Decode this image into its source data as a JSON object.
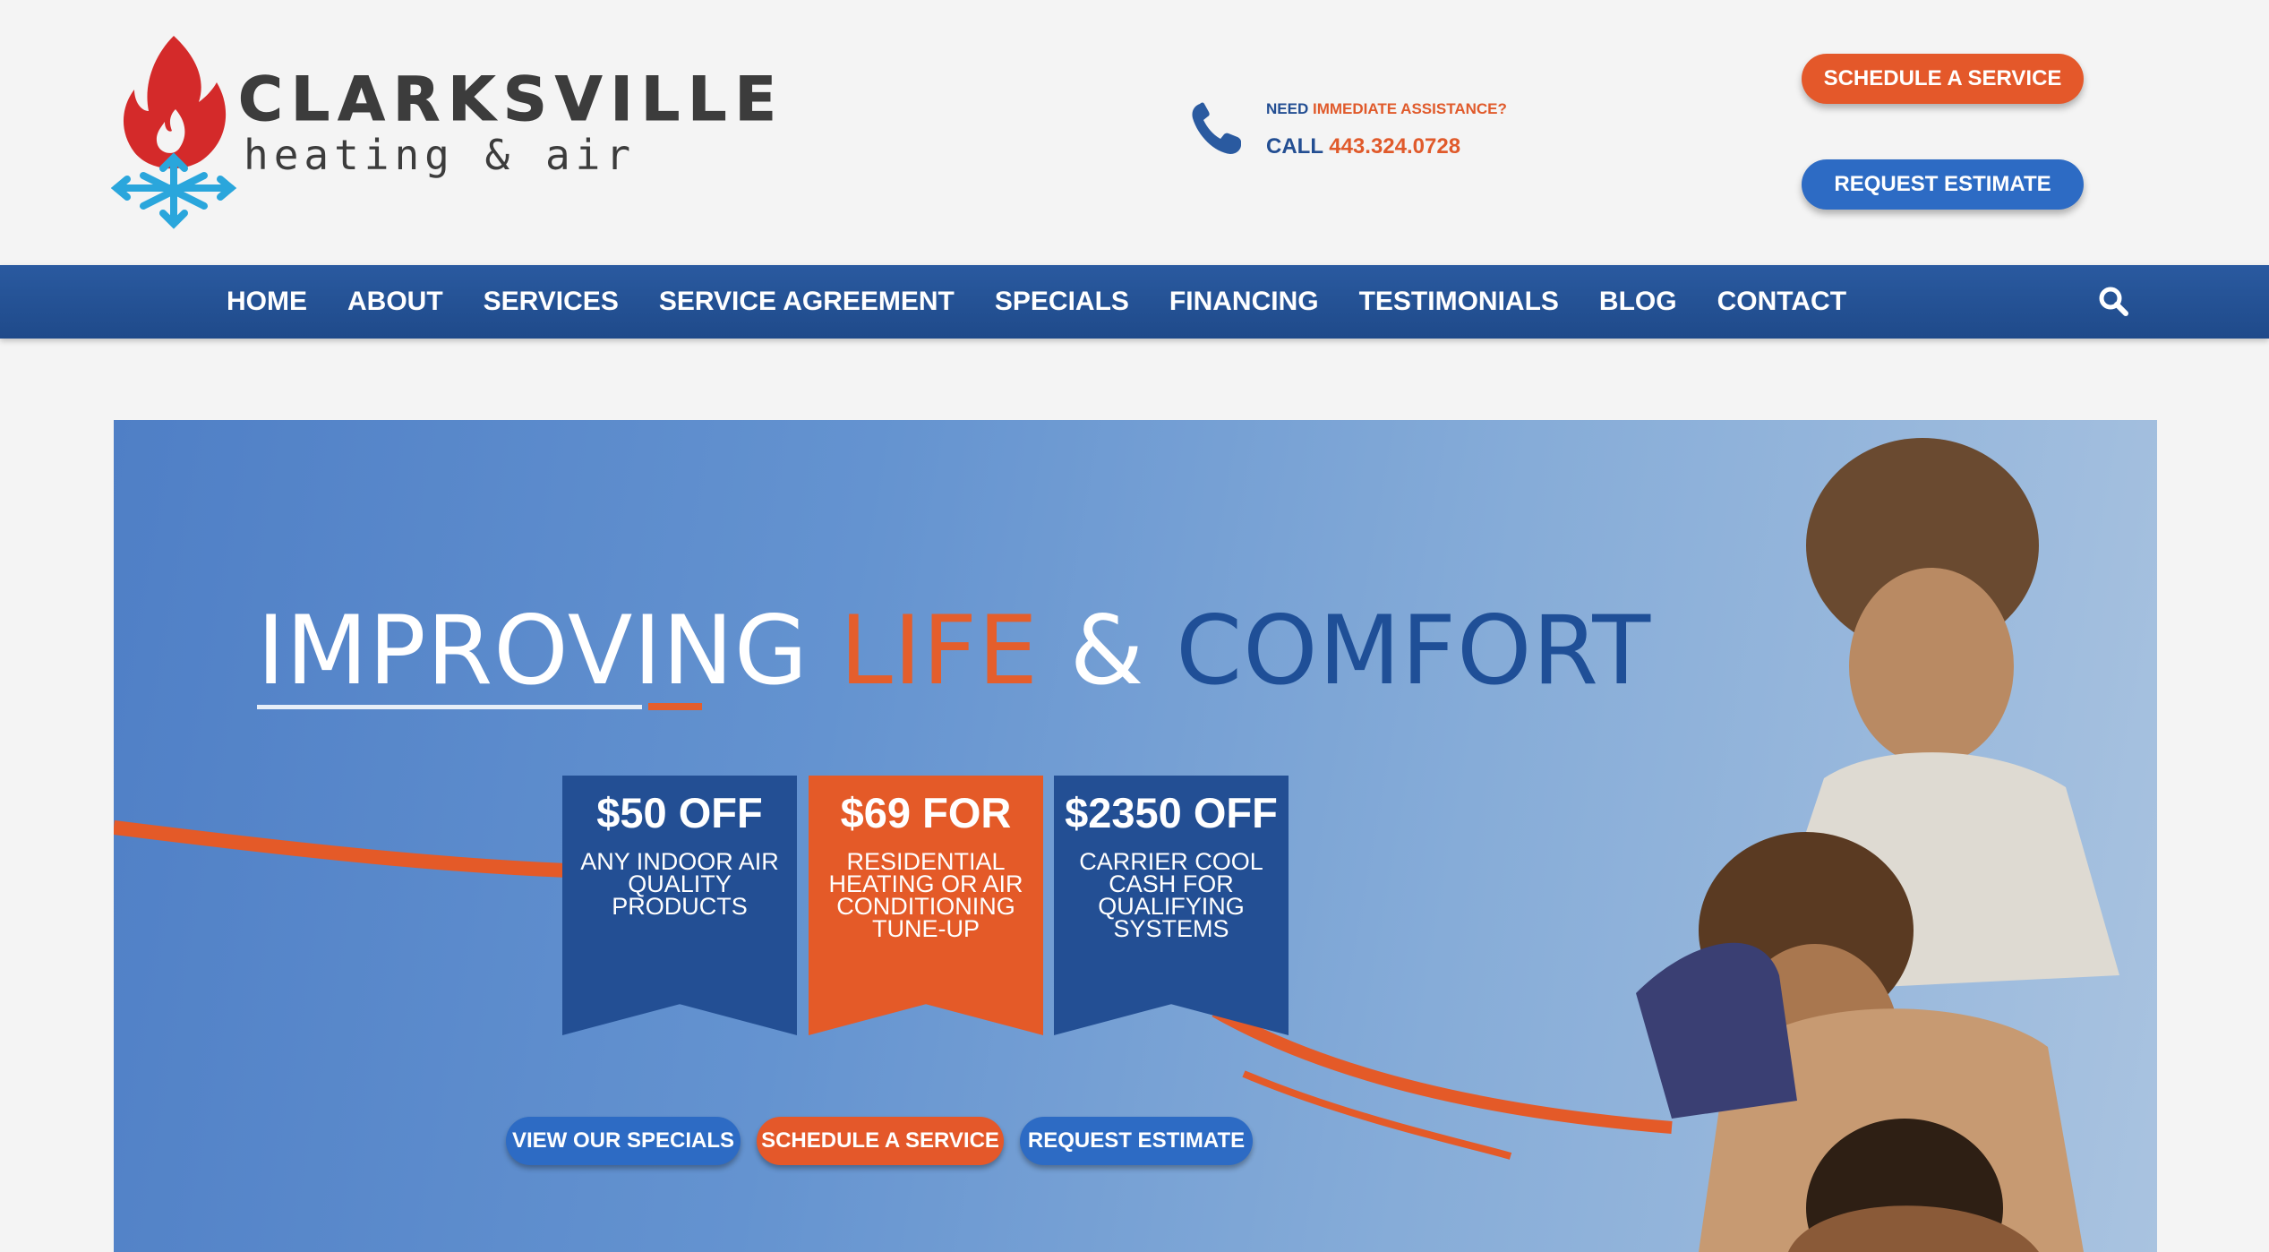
{
  "brand": {
    "name": "CLARKSVILLE",
    "tagline": "heating & air"
  },
  "contact": {
    "need_label": "NEED",
    "assistance_label": "IMMEDIATE ASSISTANCE?",
    "call_label": "CALL",
    "phone": "443.324.0728"
  },
  "header_buttons": {
    "schedule": "SCHEDULE A SERVICE",
    "estimate": "REQUEST ESTIMATE"
  },
  "nav": {
    "items": [
      "HOME",
      "ABOUT",
      "SERVICES",
      "SERVICE AGREEMENT",
      "SPECIALS",
      "FINANCING",
      "TESTIMONIALS",
      "BLOG",
      "CONTACT"
    ],
    "search_icon": "search-icon"
  },
  "hero": {
    "headline": {
      "part1": "IMPROVING",
      "part2": "LIFE",
      "part3": "&",
      "part4": "COMFORT"
    },
    "offers": [
      {
        "title": "$50 OFF",
        "desc": "ANY INDOOR AIR QUALITY PRODUCTS"
      },
      {
        "title": "$69 FOR",
        "desc": "RESIDENTIAL HEATING OR AIR CONDITIONING TUNE-UP"
      },
      {
        "title": "$2350 OFF",
        "desc": "CARRIER COOL CASH FOR QUALIFYING SYSTEMS"
      }
    ],
    "buttons": {
      "specials": "VIEW OUR SPECIALS",
      "schedule": "SCHEDULE A SERVICE",
      "estimate": "REQUEST ESTIMATE"
    }
  },
  "colors": {
    "brand_blue": "#234f94",
    "nav_blue": "#2a5aa0",
    "accent_orange": "#e45a28",
    "button_blue": "#2d6bc4"
  }
}
